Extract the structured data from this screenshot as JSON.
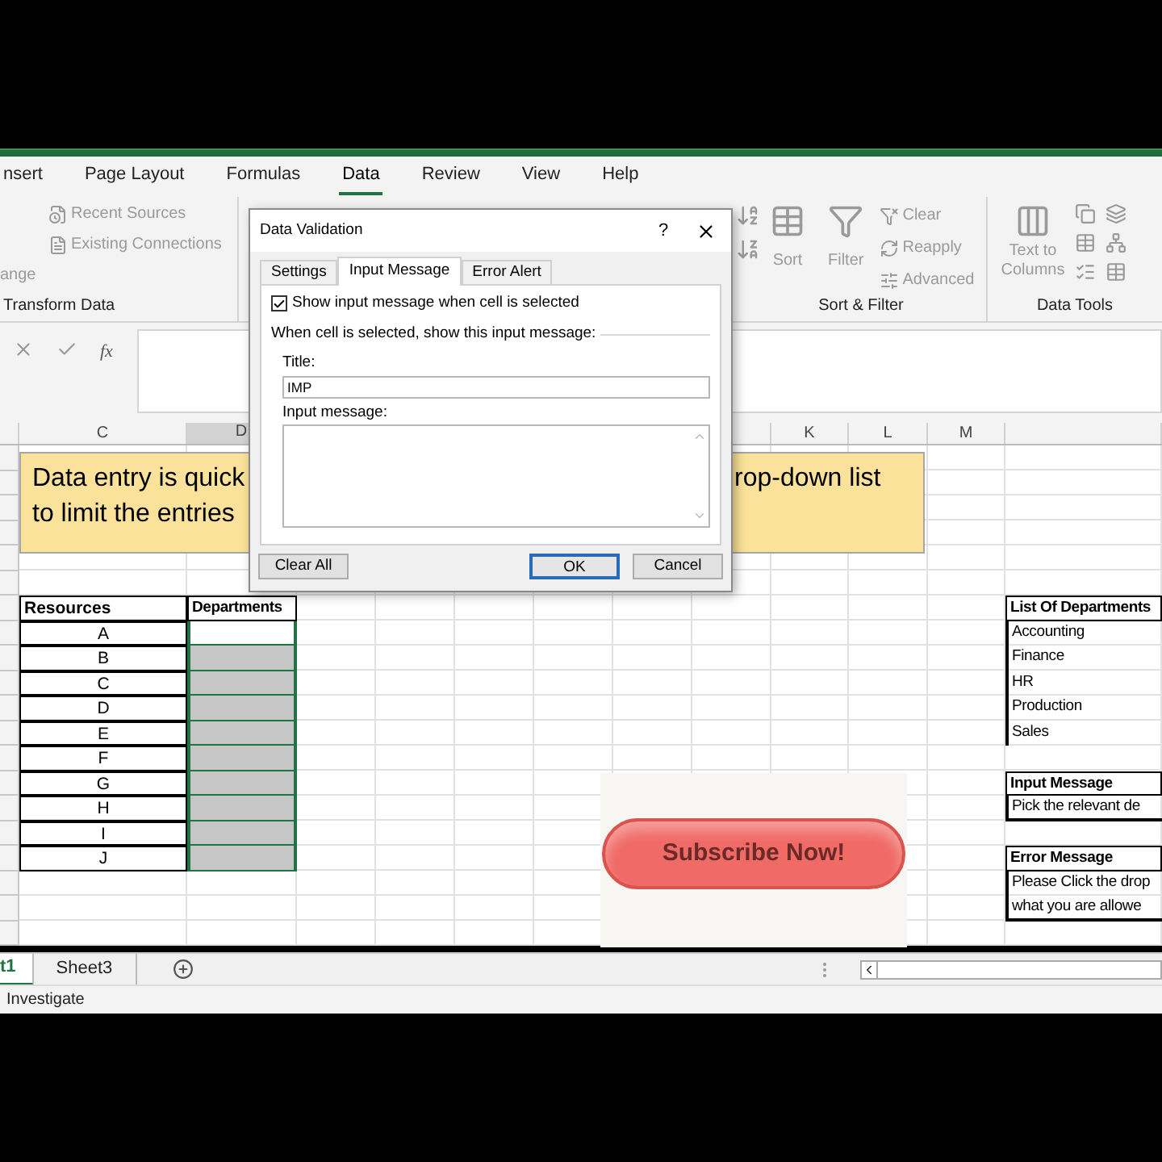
{
  "ribbon_tabs": [
    {
      "label": "nsert",
      "selected": false
    },
    {
      "label": "Page Layout",
      "selected": false
    },
    {
      "label": "Formulas",
      "selected": false
    },
    {
      "label": "Data",
      "selected": true
    },
    {
      "label": "Review",
      "selected": false
    },
    {
      "label": "View",
      "selected": false
    },
    {
      "label": "Help",
      "selected": false
    }
  ],
  "ribbon": {
    "get_data": {
      "items": [
        "Recent Sources",
        "Existing Connections"
      ],
      "cut_item": "ange",
      "label": "Transform Data"
    },
    "sort_filter": {
      "sort": "Sort",
      "filter": "Filter",
      "items": [
        "Clear",
        "Reapply",
        "Advanced"
      ],
      "label": "Sort & Filter"
    },
    "data_tools": {
      "text_to_columns": "Text to Columns",
      "label": "Data Tools"
    }
  },
  "formula_bar": {
    "function_label": "fx"
  },
  "column_headers": [
    "C",
    "D",
    "K",
    "L",
    "M"
  ],
  "text_box": {
    "left_lines": [
      "Data entry is quick",
      "to limit the entries"
    ],
    "right_line": "rop-down list"
  },
  "resources_table": {
    "headers": [
      "Resources",
      "Departments"
    ],
    "rows": [
      {
        "resource": "A",
        "highlighted": false
      },
      {
        "resource": "B",
        "highlighted": true
      },
      {
        "resource": "C",
        "highlighted": true
      },
      {
        "resource": "D",
        "highlighted": true
      },
      {
        "resource": "E",
        "highlighted": true
      },
      {
        "resource": "F",
        "highlighted": true
      },
      {
        "resource": "G",
        "highlighted": true
      },
      {
        "resource": "H",
        "highlighted": true
      },
      {
        "resource": "I",
        "highlighted": true
      },
      {
        "resource": "J",
        "highlighted": true
      }
    ]
  },
  "departments_list": {
    "header": "List Of Departments",
    "items": [
      "Accounting",
      "Finance",
      "HR",
      "Production",
      "Sales"
    ]
  },
  "input_message_box": {
    "header": "Input Message",
    "lines": [
      "Pick the relevant de"
    ]
  },
  "error_message_box": {
    "header": "Error Message",
    "lines": [
      "Please Click the drop",
      "what you are allowe"
    ]
  },
  "subscribe_button": {
    "label": "Subscribe Now!"
  },
  "dialog": {
    "title": "Data Validation",
    "help": "?",
    "tabs": [
      {
        "label": "Settings",
        "selected": false
      },
      {
        "label": "Input Message",
        "selected": true
      },
      {
        "label": "Error Alert",
        "selected": false
      }
    ],
    "show_message": {
      "label": "Show input message when cell is selected",
      "checked": true
    },
    "section_label": "When cell is selected, show this input message:",
    "title_label": "Title:",
    "title_value": "IMP",
    "message_label": "Input message:",
    "buttons": [
      {
        "label": "Clear All",
        "kind": "secondary"
      },
      {
        "label": "OK",
        "kind": "default"
      },
      {
        "label": "Cancel",
        "kind": "secondary"
      }
    ]
  },
  "sheet_tabs": [
    {
      "label": "t1",
      "selected": true
    },
    {
      "label": "Sheet3",
      "selected": false
    }
  ],
  "status_bar": {
    "text": "Investigate"
  }
}
